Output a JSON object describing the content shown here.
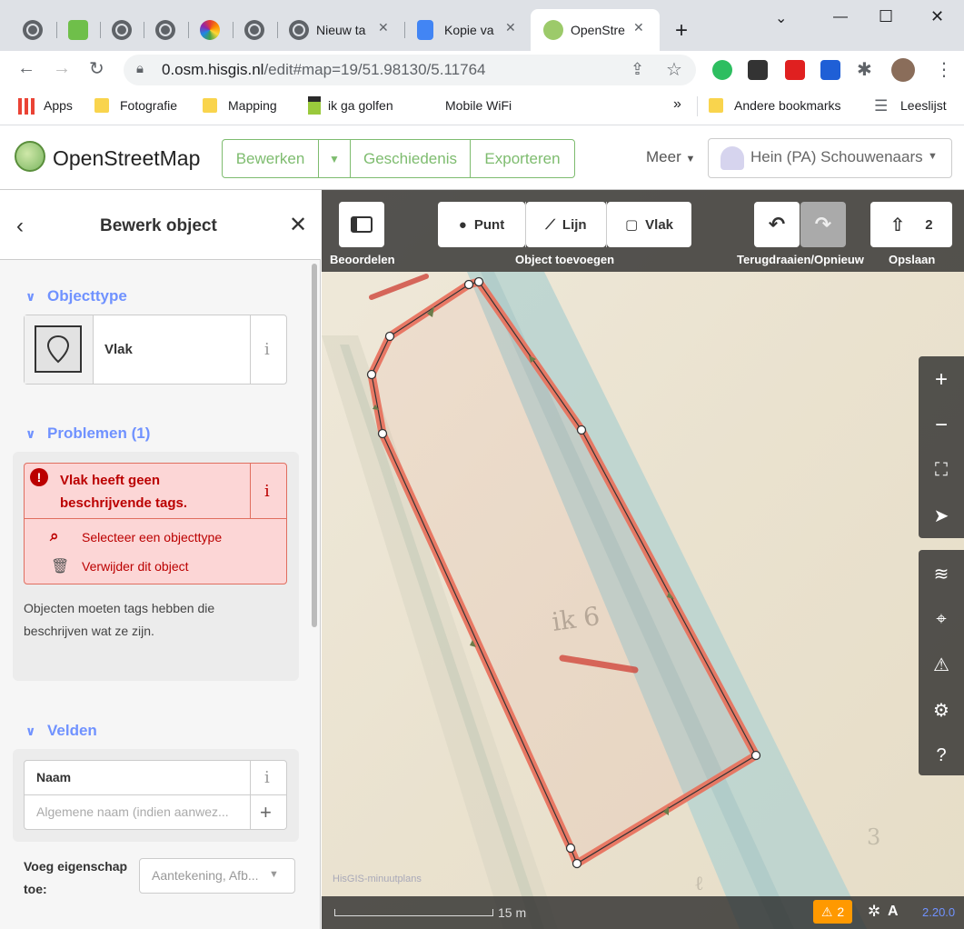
{
  "browser": {
    "tabs": [
      {
        "title": "Nieuw ta",
        "icon": "chrome-icon"
      },
      {
        "title": "Kopie va",
        "icon": "docs-icon"
      },
      {
        "title": "OpenStre",
        "icon": "osm-icon",
        "active": true
      }
    ],
    "new_tab": "+",
    "url_host": "0.osm.hisgis.nl",
    "url_path": "/edit#map=19/51.98130/5.11764",
    "bookmarks": [
      "Apps",
      "Fotografie",
      "Mapping",
      "ik ga golfen",
      "Mobile WiFi"
    ],
    "bookmarks_more": "»",
    "bookmarks_other": "Andere bookmarks",
    "reading_list": "Leeslijst"
  },
  "osm": {
    "brand": "OpenStreetMap",
    "edit": "Bewerken",
    "history": "Geschiedenis",
    "export": "Exporteren",
    "more": "Meer",
    "user": "Hein (PA) Schouwenaars"
  },
  "sidebar": {
    "title": "Bewerk object",
    "objecttype_heading": "Objecttype",
    "preset_name": "Vlak",
    "problems_heading": "Problemen (1)",
    "problem_message": "Vlak heeft geen beschrijvende tags.",
    "problem_action_select": "Selecteer een objecttype",
    "problem_action_delete": "Verwijder dit object",
    "problem_description": "Objecten moeten tags hebben die beschrijven wat ze zijn.",
    "fields_heading": "Velden",
    "name_label": "Naam",
    "name_placeholder": "Algemene naam (indien aanwez...",
    "add_property_label": "Voeg eigenschap toe:",
    "add_property_placeholder": "Aantekening, Afb...",
    "info_glyph": "i"
  },
  "map": {
    "review": "Beoordelen",
    "point": "Punt",
    "line": "Lijn",
    "area": "Vlak",
    "add_object": "Object toevoegen",
    "undo_redo": "Terugdraaien/Opnieuw",
    "save": "Opslaan",
    "save_count": "2",
    "attribution": "HisGIS-minuutplans",
    "scale": "15 m",
    "issues_count": "2",
    "version": "2.20.0"
  },
  "colors": {
    "osm_green": "#7ebc6f",
    "accent_blue": "#7092ff",
    "error_red": "#b00",
    "area_stroke": "#e86c5a"
  }
}
